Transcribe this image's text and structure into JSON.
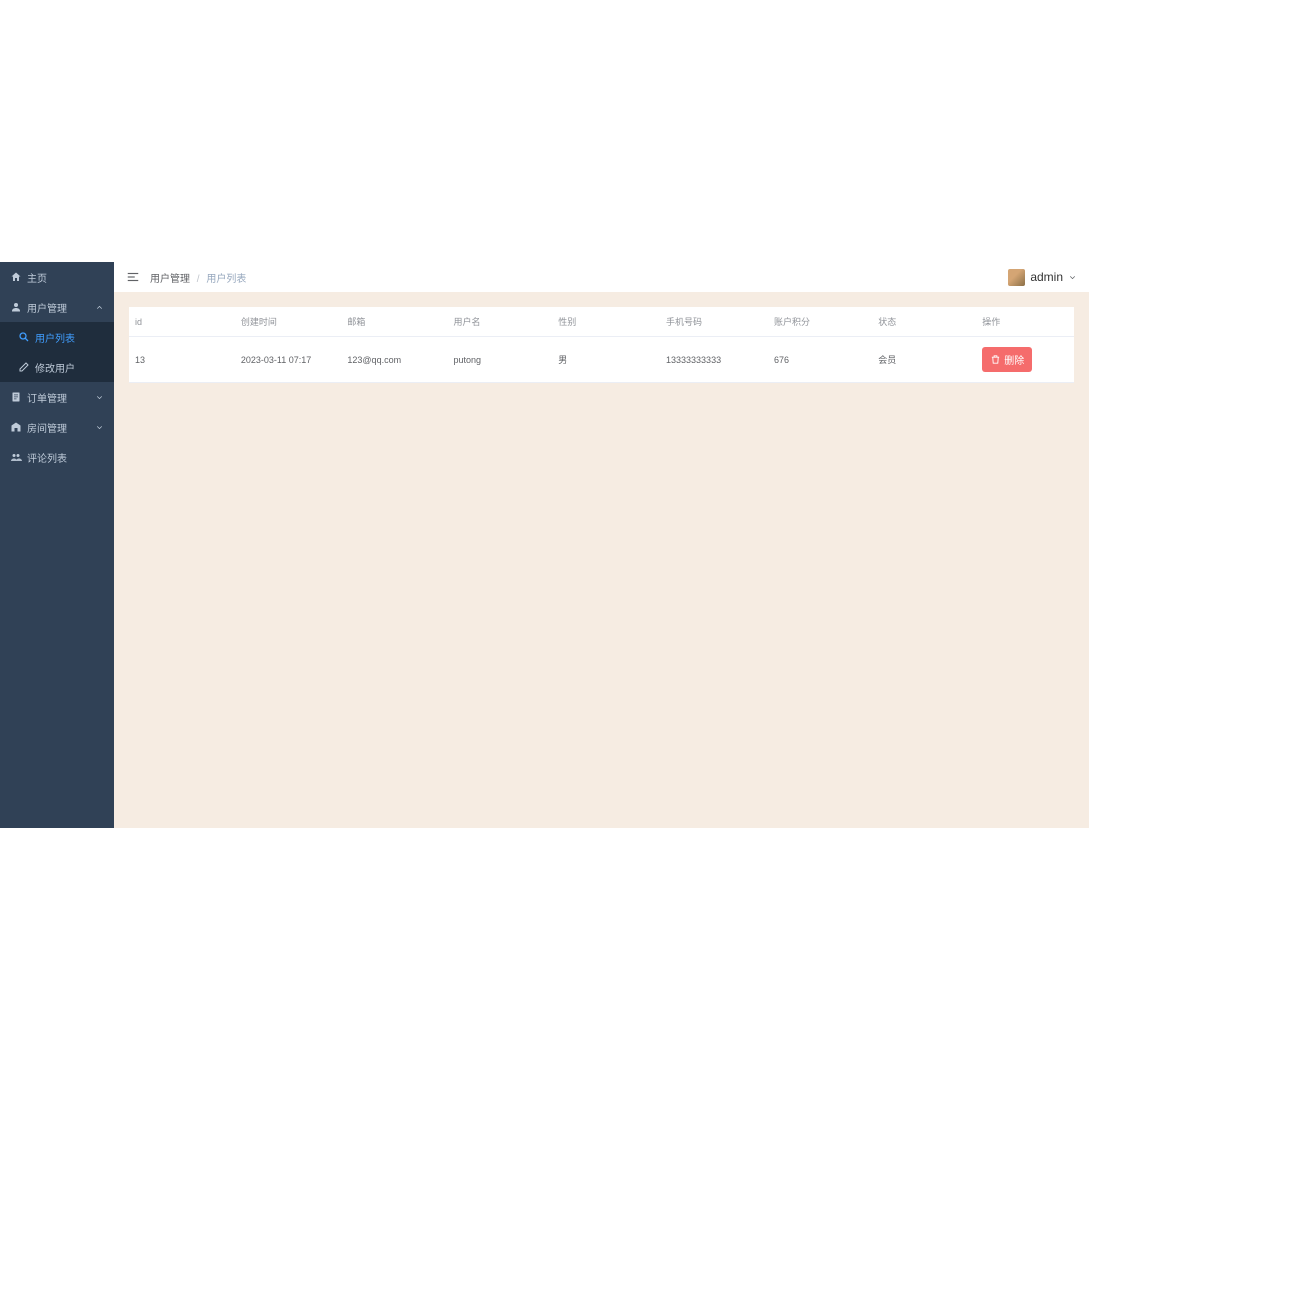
{
  "sidebar": {
    "home": "主页",
    "user_mgmt": "用户管理",
    "user_list": "用户列表",
    "edit_user": "修改用户",
    "order_mgmt": "订单管理",
    "room_mgmt": "房间管理",
    "comment_list": "评论列表"
  },
  "header": {
    "breadcrumb_parent": "用户管理",
    "breadcrumb_current": "用户列表",
    "username": "admin"
  },
  "table": {
    "headers": {
      "id": "id",
      "created": "创建时间",
      "email": "邮箱",
      "username": "用户名",
      "gender": "性别",
      "phone": "手机号码",
      "points": "账户积分",
      "status": "状态",
      "action": "操作"
    },
    "rows": [
      {
        "id": "13",
        "created": "2023-03-11 07:17",
        "email": "123@qq.com",
        "username": "putong",
        "gender": "男",
        "phone": "13333333333",
        "points": "676",
        "status": "会员"
      }
    ],
    "delete_label": "删除"
  }
}
